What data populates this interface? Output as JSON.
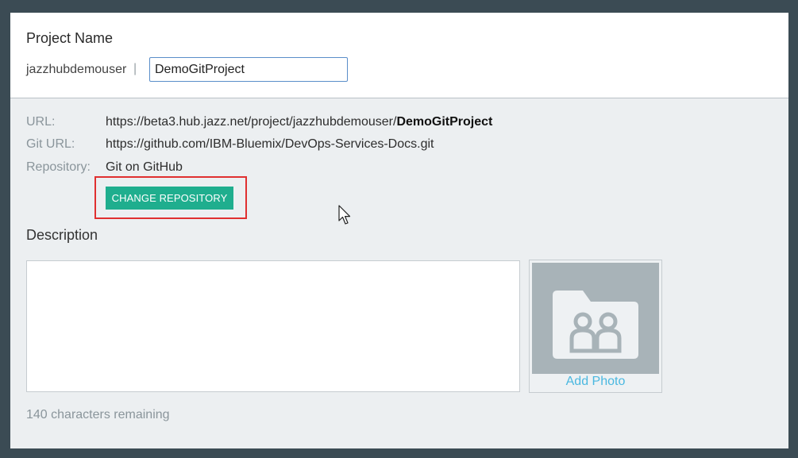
{
  "project": {
    "heading": "Project Name",
    "owner": "jazzhubdemouser",
    "separator": "|",
    "name_value": "DemoGitProject"
  },
  "info": {
    "url_label": "URL:",
    "url_prefix": "https://beta3.hub.jazz.net/project/jazzhubdemouser/",
    "url_project": "DemoGitProject",
    "git_url_label": "Git URL:",
    "git_url_value": "https://github.com/IBM-Bluemix/DevOps-Services-Docs.git",
    "repository_label": "Repository:",
    "repository_value": "Git on GitHub"
  },
  "actions": {
    "change_repository_label": "CHANGE REPOSITORY"
  },
  "description": {
    "heading": "Description",
    "value": "",
    "chars_remaining": "140 characters remaining"
  },
  "photo": {
    "add_label": "Add Photo",
    "icon": "folder-users-icon"
  },
  "colors": {
    "background": "#3b4b54",
    "panel": "#eceff1",
    "accent_button": "#1fae8e",
    "highlight": "#e03030",
    "link": "#4ab8e0"
  }
}
